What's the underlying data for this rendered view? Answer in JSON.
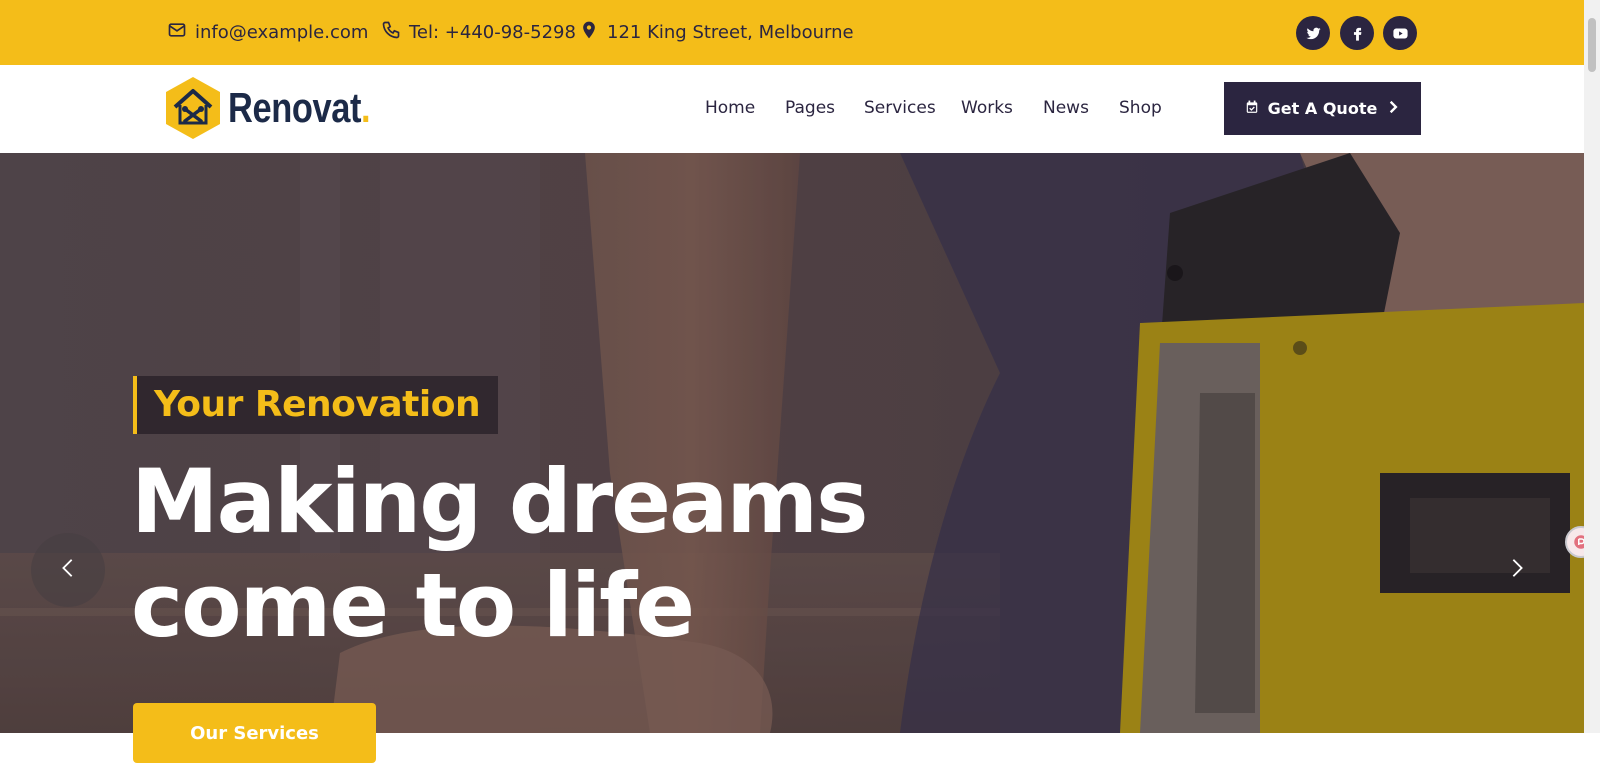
{
  "topbar": {
    "email": "info@example.com",
    "phone": "Tel: +440-98-5298",
    "address": "121 King Street, Melbourne",
    "social": [
      "twitter-icon",
      "facebook-icon",
      "youtube-icon"
    ]
  },
  "brand": {
    "name": "Renovat",
    "dot": ".",
    "accent_color": "#f4bd19",
    "dark_color": "#2b2540"
  },
  "nav": {
    "items": [
      "Home",
      "Pages",
      "Services",
      "Works",
      "News",
      "Shop"
    ],
    "quote_label": "Get A Quote"
  },
  "hero": {
    "eyebrow": "Your Renovation",
    "headline_line1": "Making dreams",
    "headline_line2": "come to life",
    "cta_label": "Our Services"
  },
  "icons": {
    "email": "envelope-icon",
    "phone": "phone-icon",
    "address": "map-pin-icon",
    "quote": "calendar-check-icon",
    "prev": "chevron-left-icon",
    "next": "chevron-right-icon"
  }
}
